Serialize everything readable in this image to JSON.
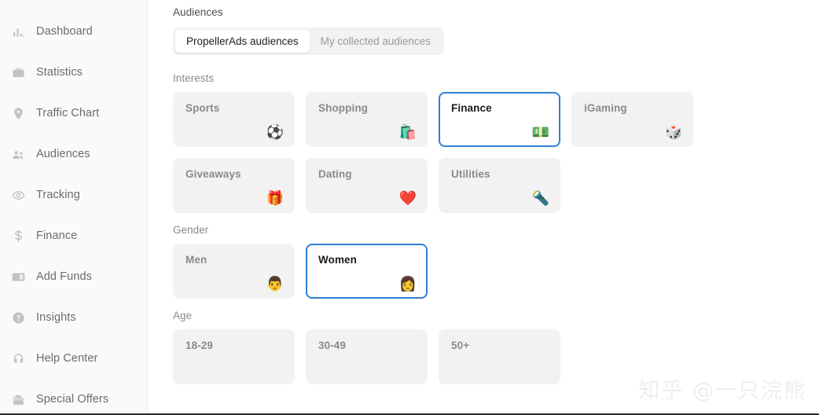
{
  "sidebar": {
    "items": [
      {
        "label": "Dashboard",
        "icon": "bar-chart-icon"
      },
      {
        "label": "Statistics",
        "icon": "briefcase-icon"
      },
      {
        "label": "Traffic Chart",
        "icon": "map-pin-plus-icon"
      },
      {
        "label": "Audiences",
        "icon": "people-icon"
      },
      {
        "label": "Tracking",
        "icon": "eye-icon"
      },
      {
        "label": "Finance",
        "icon": "dollar-sign-icon"
      },
      {
        "label": "Add Funds",
        "icon": "wallet-icon"
      },
      {
        "label": "Insights",
        "icon": "question-circle-icon"
      },
      {
        "label": "Help Center",
        "icon": "headset-icon"
      },
      {
        "label": "Special Offers",
        "icon": "gift-box-icon"
      }
    ]
  },
  "main": {
    "page_title": "Audiences",
    "tabs": [
      {
        "label": "PropellerAds audiences",
        "active": true
      },
      {
        "label": "My collected audiences",
        "active": false
      }
    ],
    "sections": {
      "interests": {
        "label": "Interests",
        "rows": [
          [
            {
              "title": "Sports",
              "emoji": "⚽",
              "icon": "soccer-ball-icon",
              "selected": false
            },
            {
              "title": "Shopping",
              "emoji": "🛍️",
              "icon": "shopping-bags-icon",
              "selected": false
            },
            {
              "title": "Finance",
              "emoji": "💵",
              "icon": "banknote-icon",
              "selected": true
            },
            {
              "title": "iGaming",
              "emoji": "🎲",
              "icon": "dice-icon",
              "selected": false
            }
          ],
          [
            {
              "title": "Giveaways",
              "emoji": "🎁",
              "icon": "gift-icon",
              "selected": false
            },
            {
              "title": "Dating",
              "emoji": "❤️",
              "icon": "heart-icon",
              "selected": false
            },
            {
              "title": "Utilities",
              "emoji": "🔦",
              "icon": "flashlight-icon",
              "selected": false
            }
          ]
        ]
      },
      "gender": {
        "label": "Gender",
        "rows": [
          [
            {
              "title": "Men",
              "emoji": "👨",
              "icon": "man-face-icon",
              "selected": false
            },
            {
              "title": "Women",
              "emoji": "👩",
              "icon": "woman-face-icon",
              "selected": true
            }
          ]
        ]
      },
      "age": {
        "label": "Age",
        "rows": [
          [
            {
              "title": "18-29",
              "emoji": "",
              "icon": "",
              "selected": false
            },
            {
              "title": "30-49",
              "emoji": "",
              "icon": "",
              "selected": false
            },
            {
              "title": "50+",
              "emoji": "",
              "icon": "",
              "selected": false
            }
          ]
        ]
      }
    },
    "watermark": "知乎 @一只浣熊"
  },
  "colors": {
    "accent": "#2f80d8",
    "card_bg": "#f2f2f3",
    "sidebar_bg": "#fafafa",
    "muted_text": "#8a8a8e"
  }
}
